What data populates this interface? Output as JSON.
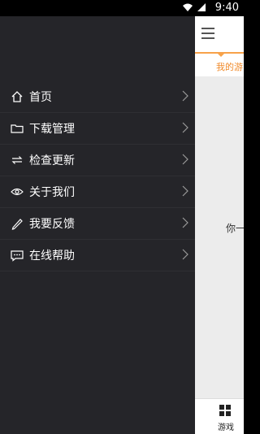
{
  "status_bar": {
    "time": "9:40",
    "icons": [
      "wifi-icon",
      "signal-icon"
    ]
  },
  "drawer": {
    "items": [
      {
        "label": "首页",
        "icon": "home-icon"
      },
      {
        "label": "下载管理",
        "icon": "folder-icon"
      },
      {
        "label": "检查更新",
        "icon": "refresh-icon"
      },
      {
        "label": "关于我们",
        "icon": "eye-icon"
      },
      {
        "label": "我要反馈",
        "icon": "pencil-icon"
      },
      {
        "label": "在线帮助",
        "icon": "chat-icon"
      }
    ]
  },
  "main": {
    "tab_label": "我的游",
    "empty_text": "你一",
    "bottom_nav": {
      "label": "游戏",
      "icon": "grid-icon"
    }
  },
  "colors": {
    "accent": "#f7a24a",
    "drawer_bg": "#252529",
    "content_bg": "#ececec"
  }
}
